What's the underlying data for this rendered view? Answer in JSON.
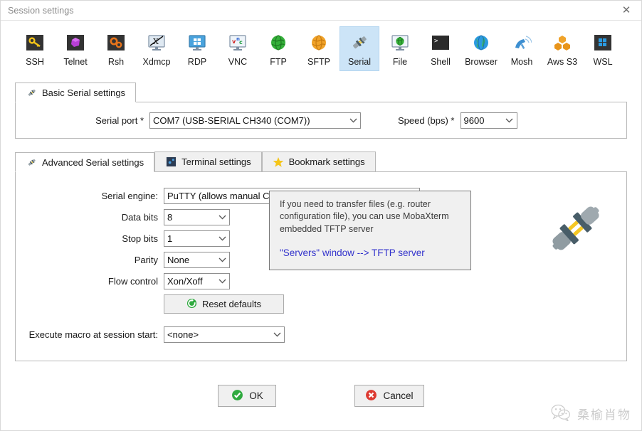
{
  "window": {
    "title": "Session settings",
    "close_label": "✕"
  },
  "session_types": [
    {
      "id": "ssh",
      "label": "SSH",
      "icon": "key-icon",
      "selected": false
    },
    {
      "id": "telnet",
      "label": "Telnet",
      "icon": "gem-icon",
      "selected": false
    },
    {
      "id": "rsh",
      "label": "Rsh",
      "icon": "gears-icon",
      "selected": false
    },
    {
      "id": "xdmcp",
      "label": "Xdmcp",
      "icon": "x-monitor-icon",
      "selected": false
    },
    {
      "id": "rdp",
      "label": "RDP",
      "icon": "windows-monitor-icon",
      "selected": false
    },
    {
      "id": "vnc",
      "label": "VNC",
      "icon": "vnc-monitor-icon",
      "selected": false
    },
    {
      "id": "ftp",
      "label": "FTP",
      "icon": "green-globe-icon",
      "selected": false
    },
    {
      "id": "sftp",
      "label": "SFTP",
      "icon": "orange-globe-icon",
      "selected": false
    },
    {
      "id": "serial",
      "label": "Serial",
      "icon": "plug-icon",
      "selected": true
    },
    {
      "id": "file",
      "label": "File",
      "icon": "globe-monitor-icon",
      "selected": false
    },
    {
      "id": "shell",
      "label": "Shell",
      "icon": "terminal-icon",
      "selected": false
    },
    {
      "id": "browser",
      "label": "Browser",
      "icon": "blue-globe-icon",
      "selected": false
    },
    {
      "id": "mosh",
      "label": "Mosh",
      "icon": "satellite-icon",
      "selected": false
    },
    {
      "id": "awss3",
      "label": "Aws S3",
      "icon": "aws-cubes-icon",
      "selected": false
    },
    {
      "id": "wsl",
      "label": "WSL",
      "icon": "windows-icon",
      "selected": false
    }
  ],
  "basic": {
    "tab_label": "Basic Serial settings",
    "tab_icon": "plug-icon",
    "serial_port_label": "Serial port *",
    "serial_port_value": "COM7  (USB-SERIAL CH340 (COM7))",
    "speed_label": "Speed (bps) *",
    "speed_value": "9600"
  },
  "advanced": {
    "tabs": [
      {
        "id": "advanced",
        "label": "Advanced Serial settings",
        "icon": "plug-icon",
        "active": true
      },
      {
        "id": "terminal",
        "label": "Terminal settings",
        "icon": "terminal-settings-icon",
        "active": false
      },
      {
        "id": "bookmark",
        "label": "Bookmark settings",
        "icon": "star-icon",
        "active": false
      }
    ],
    "serial_engine_label": "Serial engine:",
    "serial_engine_value": "PuTTY   (allows manual COM port setting)",
    "data_bits_label": "Data bits",
    "data_bits_value": "8",
    "stop_bits_label": "Stop bits",
    "stop_bits_value": "1",
    "parity_label": "Parity",
    "parity_value": "None",
    "flow_control_label": "Flow control",
    "flow_control_value": "Xon/Xoff",
    "reset_defaults_label": "Reset defaults",
    "reset_icon": "refresh-icon",
    "info_text": "If you need to transfer files (e.g. router configuration file), you can use MobaXterm embedded TFTP server",
    "info_link": "\"Servers\" window  -->  TFTP server",
    "macro_label": "Execute macro at session start:",
    "macro_value": "<none>",
    "decoration_icon": "plug-large-icon"
  },
  "footer": {
    "ok_label": "OK",
    "ok_icon": "check-circle-icon",
    "cancel_label": "Cancel",
    "cancel_icon": "x-circle-icon"
  },
  "watermark": {
    "icon": "wechat-icon",
    "text": "桑榆肖物"
  },
  "colors": {
    "selection": "#cce4f7",
    "link": "#3333cc",
    "ok_green": "#2faa3f",
    "cancel_red": "#dd3b32",
    "border": "#b8b8b8"
  }
}
